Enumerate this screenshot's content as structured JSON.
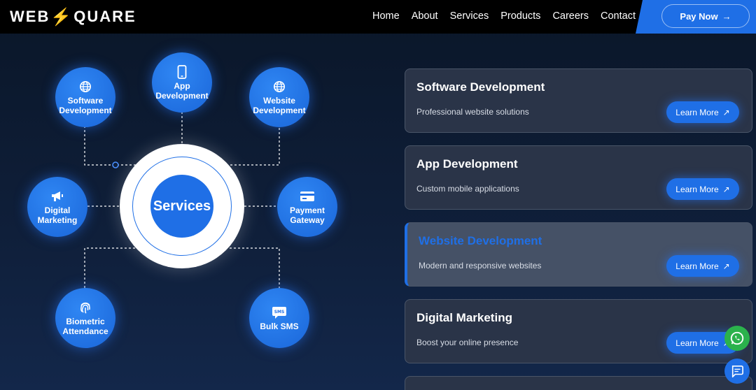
{
  "header": {
    "logo_left": "WEB",
    "logo_right": "QUARE",
    "nav": [
      "Home",
      "About",
      "Services",
      "Products",
      "Careers",
      "Contact"
    ],
    "pay_label": "Pay Now"
  },
  "diagram": {
    "center_label": "Services",
    "nodes": {
      "software": "Software\nDevelopment",
      "app": "App\nDevelopment",
      "website": "Website\nDevelopment",
      "marketing": "Digital\nMarketing",
      "payment": "Payment\nGateway",
      "biometric": "Biometric\nAttendance",
      "sms": "Bulk SMS"
    }
  },
  "cards": [
    {
      "title": "Software Development",
      "desc": "Professional website solutions",
      "button": "Learn More"
    },
    {
      "title": "App Development",
      "desc": "Custom mobile applications",
      "button": "Learn More"
    },
    {
      "title": "Website Development",
      "desc": "Modern and responsive websites",
      "button": "Learn More"
    },
    {
      "title": "Digital Marketing",
      "desc": "Boost your online presence",
      "button": "Learn More"
    }
  ],
  "colors": {
    "accent": "#1f6fe6",
    "whatsapp": "#2bb24c"
  }
}
